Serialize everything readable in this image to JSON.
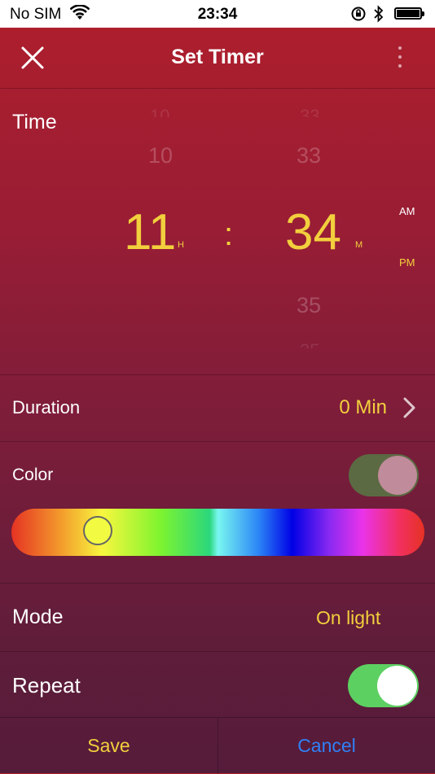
{
  "status_bar": {
    "carrier": "No SIM",
    "time": "23:34",
    "icons": [
      "wifi-icon",
      "orientation-lock-icon",
      "bluetooth-icon",
      "battery-icon"
    ]
  },
  "nav": {
    "title": "Set Timer",
    "close_icon": "close-icon",
    "more_icon": "more-vertical-icon"
  },
  "time_picker": {
    "label": "Time",
    "hour_above": "10",
    "hour": "11",
    "hour_unit": "H",
    "separator": ":",
    "minute_above": "33",
    "minute": "34",
    "minute_unit": "M",
    "minute_below": "35",
    "am_label": "AM",
    "pm_label": "PM",
    "selected_period": "PM"
  },
  "duration": {
    "label": "Duration",
    "value": "0 Min"
  },
  "color": {
    "label": "Color",
    "enabled": false,
    "selected_hue_fraction": 0.21
  },
  "mode": {
    "label": "Mode",
    "value": "On light"
  },
  "repeat": {
    "label": "Repeat",
    "enabled": true
  },
  "actions": {
    "save": "Save",
    "cancel": "Cancel"
  },
  "colors": {
    "accent_yellow": "#f2cf3d",
    "cancel_blue": "#2f80f6",
    "toggle_on_green": "#5dd062",
    "toggle_off_olive": "#5b6a42"
  }
}
